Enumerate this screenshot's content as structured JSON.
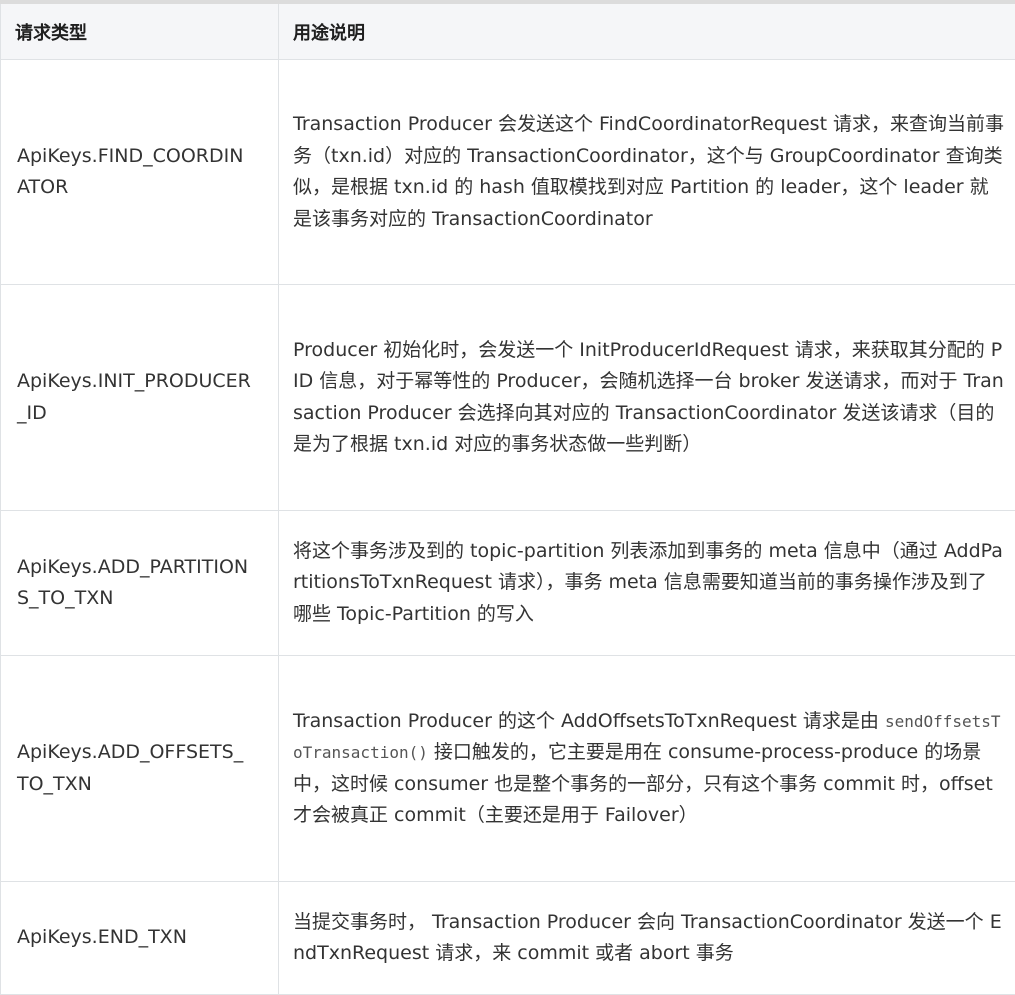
{
  "table": {
    "headers": {
      "type": "请求类型",
      "desc": "用途说明"
    },
    "rows": [
      {
        "type": "ApiKeys.FIND_COORDINATOR",
        "desc": "Transaction Producer 会发送这个 FindCoordinatorRequest 请求，来查询当前事务（txn.id）对应的 TransactionCoordinator，这个与 GroupCoordinator 查询类似，是根据 txn.id 的 hash 值取模找到对应 Partition 的 leader，这个 leader 就是该事务对应的 TransactionCoordinator"
      },
      {
        "type": "ApiKeys.INIT_PRODUCER_ID",
        "desc": "Producer 初始化时，会发送一个 InitProducerIdRequest 请求，来获取其分配的 PID 信息，对于幂等性的 Producer，会随机选择一台 broker 发送请求，而对于 Transaction Producer 会选择向其对应的 TransactionCoordinator 发送该请求（目的是为了根据 txn.id 对应的事务状态做一些判断）"
      },
      {
        "type": "ApiKeys.ADD_PARTITIONS_TO_TXN",
        "desc": "将这个事务涉及到的 topic-partition 列表添加到事务的 meta 信息中（通过 AddPartitionsToTxnRequest 请求），事务 meta 信息需要知道当前的事务操作涉及到了哪些 Topic-Partition 的写入"
      },
      {
        "type": "ApiKeys.ADD_OFFSETS_TO_TXN",
        "desc_before": "Transaction Producer 的这个 AddOffsetsToTxnRequest 请求是由 ",
        "desc_code": "sendOffsetsToTransaction()",
        "desc_after": " 接口触发的，它主要是用在 consume-process-produce 的场景中，这时候 consumer 也是整个事务的一部分，只有这个事务 commit 时，offset 才会被真正 commit（主要还是用于 Failover）"
      },
      {
        "type": "ApiKeys.END_TXN",
        "desc": "当提交事务时， Transaction Producer 会向 TransactionCoordinator 发送一个 EndTxnRequest 请求，来 commit 或者 abort 事务"
      }
    ]
  }
}
